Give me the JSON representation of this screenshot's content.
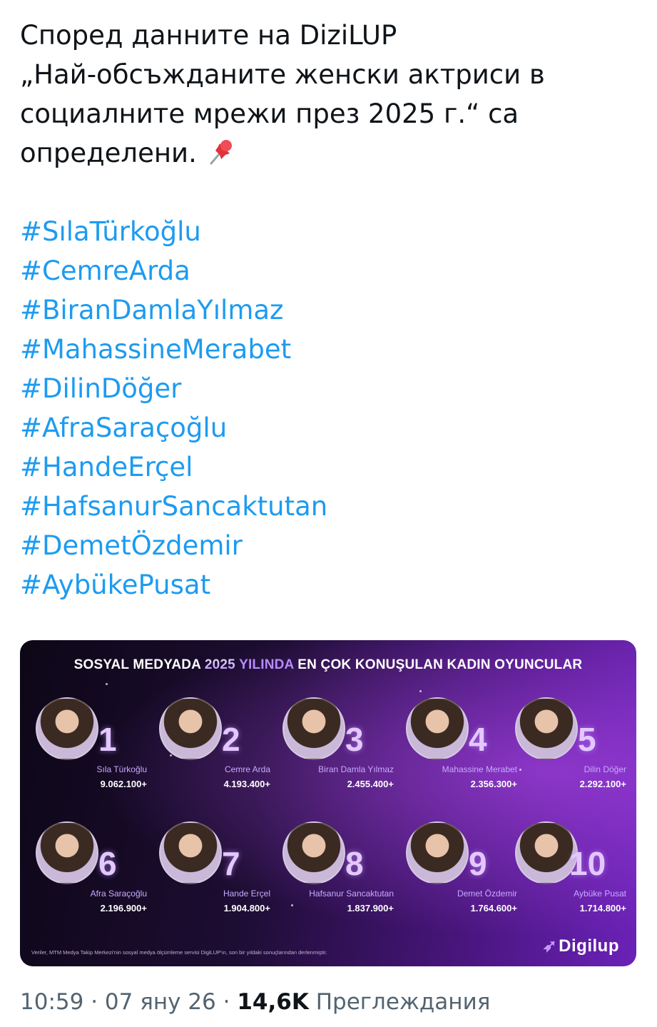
{
  "tweet": {
    "text_lines": [
      "Според данните на DiziLUP",
      "„Най-обсъжданите женски актриси в",
      "социалните мрежи през 2025 г.“ са",
      "определени."
    ],
    "emoji_icon": "pushpin-icon",
    "hashtags": [
      "#SılaTürkoğlu",
      "#CemreArda",
      "#BiranDamlaYılmaz",
      "#MahassineMerabet",
      "#DilinDöğer",
      "#AfraSaraçoğlu",
      "#HandeErçel",
      "#HafsanurSancaktutan",
      "#DemetÖzdemir",
      "#AybükePusat"
    ]
  },
  "card": {
    "title_part1": "SOSYAL MEDYADA ",
    "title_year": "2025",
    "title_part2": " YILINDA",
    "title_part3": " EN ÇOK KONUŞULAN KADIN OYUNCULAR",
    "actresses": [
      {
        "rank": "1",
        "name": "Sıla Türkoğlu",
        "count": "9.062.100+"
      },
      {
        "rank": "2",
        "name": "Cemre Arda",
        "count": "4.193.400+"
      },
      {
        "rank": "3",
        "name": "Biran Damla Yılmaz",
        "count": "2.455.400+"
      },
      {
        "rank": "4",
        "name": "Mahassine Merabet",
        "count": "2.356.300+"
      },
      {
        "rank": "5",
        "name": "Dilin Döğer",
        "count": "2.292.100+"
      },
      {
        "rank": "6",
        "name": "Afra Saraçoğlu",
        "count": "2.196.900+"
      },
      {
        "rank": "7",
        "name": "Hande Erçel",
        "count": "1.904.800+"
      },
      {
        "rank": "8",
        "name": "Hafsanur Sancaktutan",
        "count": "1.837.900+"
      },
      {
        "rank": "9",
        "name": "Demet Özdemir",
        "count": "1.764.600+"
      },
      {
        "rank": "10",
        "name": "Aybüke Pusat",
        "count": "1.714.800+"
      }
    ],
    "footnote": "Veriler, MTM Medya Takip Merkezi'nin sosyal medya ölçümleme servisi DigiLUP'ın, son bir yıldaki sonuçlarından derlenmiştir.",
    "brand": "Digilup"
  },
  "meta": {
    "time": "10:59",
    "sep1": " · ",
    "date": "07 яну 26",
    "sep2": " · ",
    "views": "14,6K",
    "views_label": " Преглеждания"
  }
}
